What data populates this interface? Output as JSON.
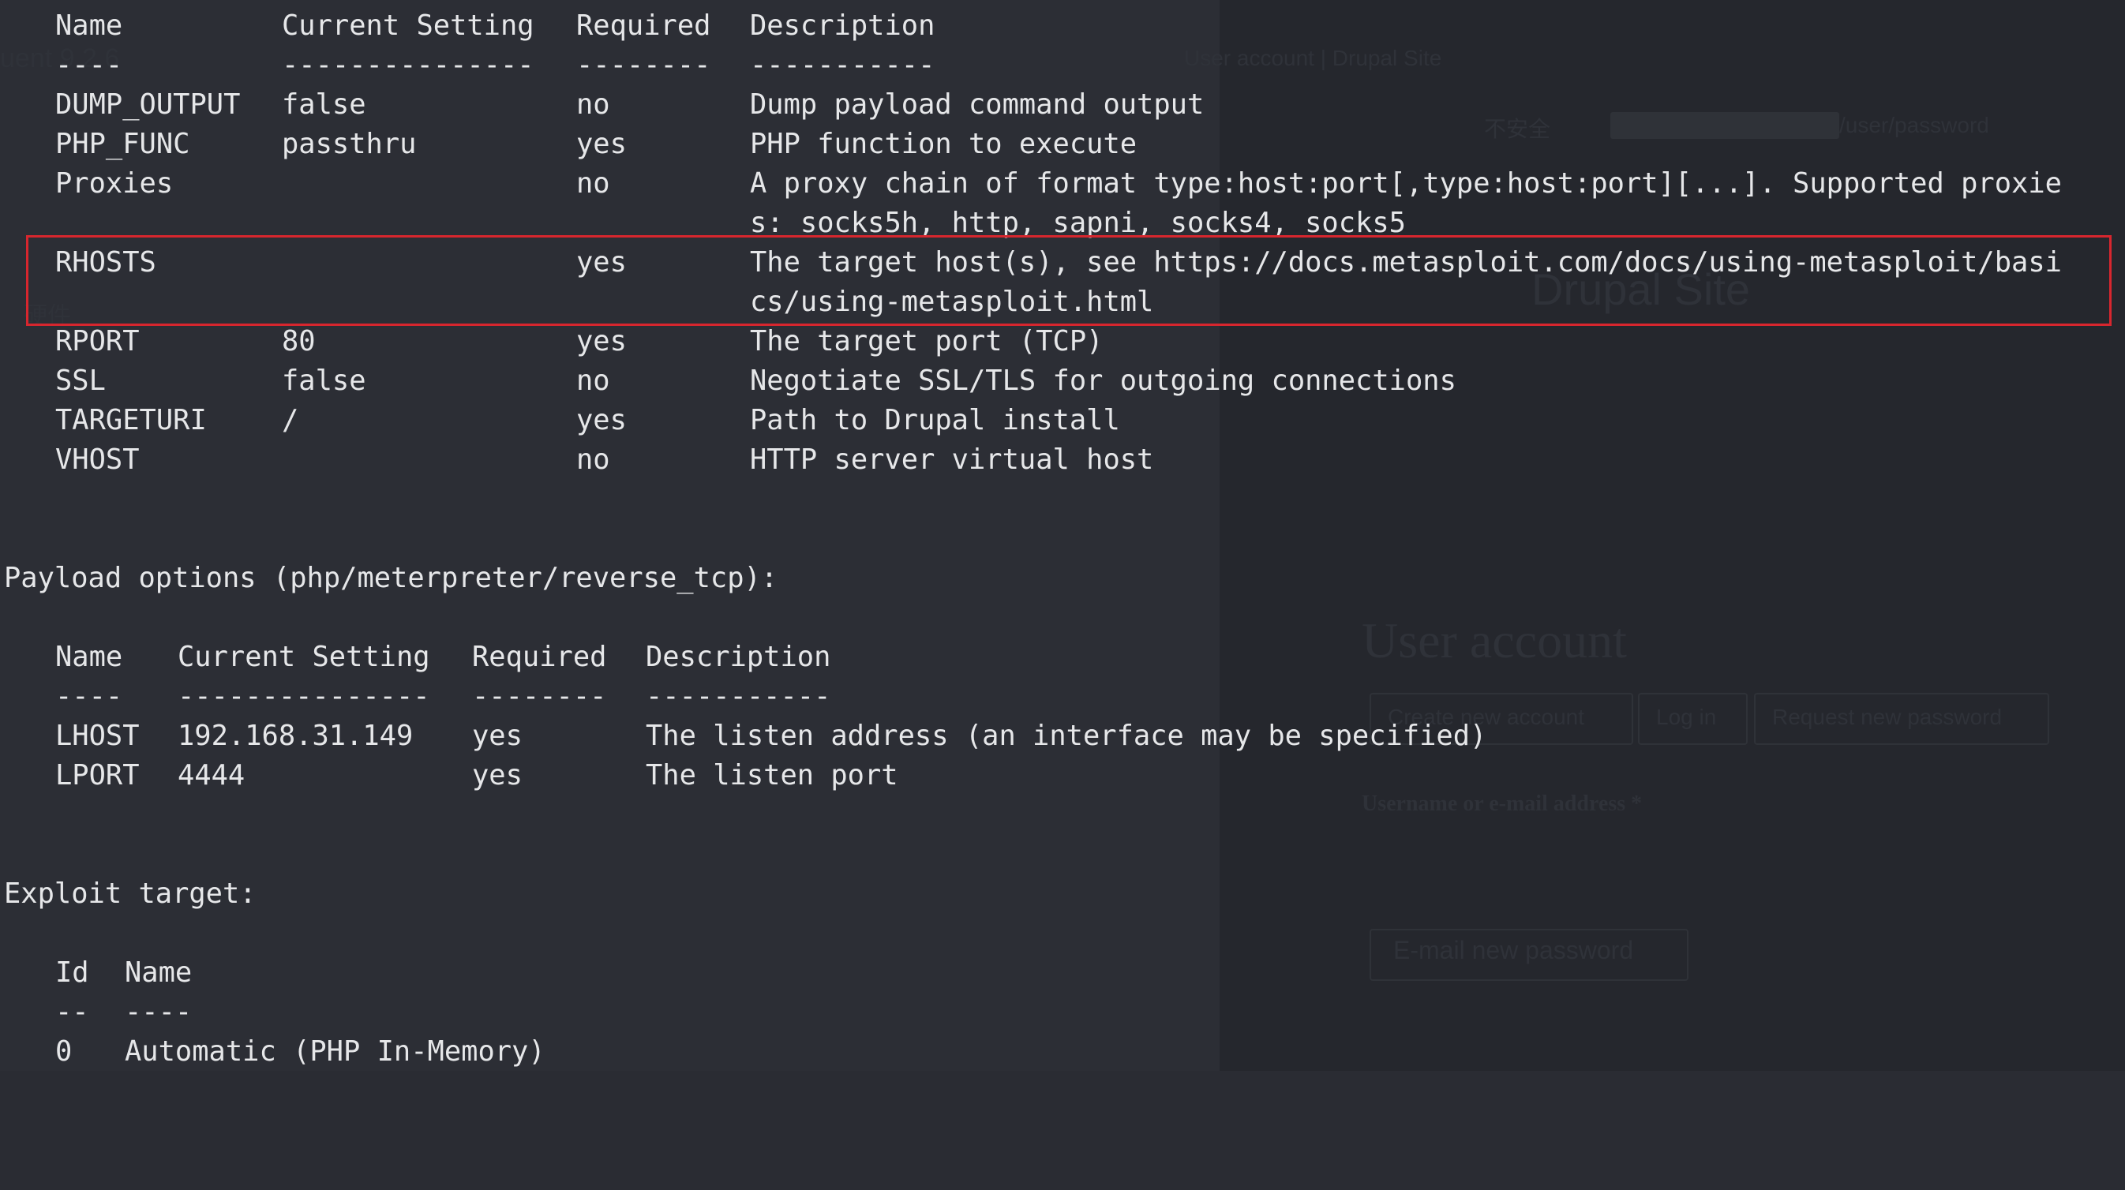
{
  "background": {
    "tab_title": "User account | Drupal Site",
    "insecure_label": "不安全",
    "url_path": "/user/password",
    "site_name": "Drupal Site",
    "page_heading": "User account",
    "tabs": [
      "Create new account",
      "Log in",
      "Request new password"
    ],
    "field_label": "Username or e-mail address *",
    "submit_button": "E-mail new password",
    "left_fragment_1": "uent 9.2.6",
    "left_fragment_2": "硬件"
  },
  "module_options": {
    "headers": [
      "Name",
      "Current Setting",
      "Required",
      "Description"
    ],
    "separators": [
      "----",
      "---------------",
      "--------",
      "-----------"
    ],
    "rows": [
      {
        "name": "DUMP_OUTPUT",
        "setting": "false",
        "required": "no",
        "description": "Dump payload command output"
      },
      {
        "name": "PHP_FUNC",
        "setting": "passthru",
        "required": "yes",
        "description": "PHP function to execute"
      },
      {
        "name": "Proxies",
        "setting": "",
        "required": "no",
        "description": "A proxy chain of format type:host:port[,type:host:port][...]. Supported proxie",
        "description_cont": "s: socks5h, http, sapni, socks4, socks5"
      },
      {
        "name": "RHOSTS",
        "setting": "",
        "required": "yes",
        "description": "The target host(s), see https://docs.metasploit.com/docs/using-metasploit/basi",
        "description_cont": "cs/using-metasploit.html"
      },
      {
        "name": "RPORT",
        "setting": "80",
        "required": "yes",
        "description": "The target port (TCP)"
      },
      {
        "name": "SSL",
        "setting": "false",
        "required": "no",
        "description": "Negotiate SSL/TLS for outgoing connections"
      },
      {
        "name": "TARGETURI",
        "setting": "/",
        "required": "yes",
        "description": "Path to Drupal install"
      },
      {
        "name": "VHOST",
        "setting": "",
        "required": "no",
        "description": "HTTP server virtual host"
      }
    ]
  },
  "payload_section": {
    "title": "Payload options (php/meterpreter/reverse_tcp):",
    "headers": [
      "Name",
      "Current Setting",
      "Required",
      "Description"
    ],
    "separators": [
      "----",
      "---------------",
      "--------",
      "-----------"
    ],
    "rows": [
      {
        "name": "LHOST",
        "setting": "192.168.31.149",
        "required": "yes",
        "description": "The listen address (an interface may be specified)"
      },
      {
        "name": "LPORT",
        "setting": "4444",
        "required": "yes",
        "description": "The listen port"
      }
    ]
  },
  "exploit_target": {
    "title": "Exploit target:",
    "headers": [
      "Id",
      "Name"
    ],
    "separators": [
      "--",
      "----"
    ],
    "rows": [
      {
        "id": "0",
        "name": "Automatic (PHP In-Memory)"
      }
    ]
  },
  "colors": {
    "terminal_bg": "#2a2c33",
    "text": "#e6e7e9",
    "highlight_box": "#d7262e"
  }
}
